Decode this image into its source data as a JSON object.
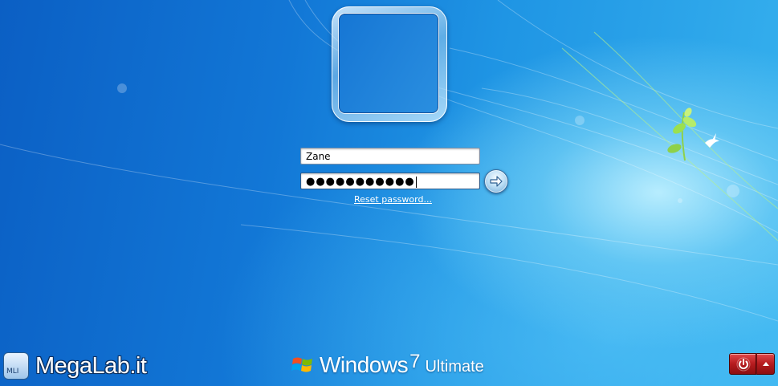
{
  "login": {
    "username_value": "Zane",
    "password_mask": "●●●●●●●●●●●",
    "reset_link": "Reset password..."
  },
  "branding": {
    "os_name": "Windows",
    "os_version": "7",
    "edition": "Ultimate"
  },
  "watermark": {
    "badge": "MLI",
    "site": "MegaLab.it"
  },
  "icons": {
    "submit": "arrow-right-icon",
    "shutdown": "power-icon",
    "shutdown_options": "chevron-up-icon",
    "os_logo": "windows-flag-icon"
  },
  "colors": {
    "desktop_blue": "#1277d6",
    "shutdown_red": "#b51b1e",
    "field_border": "#2b5a8c"
  }
}
